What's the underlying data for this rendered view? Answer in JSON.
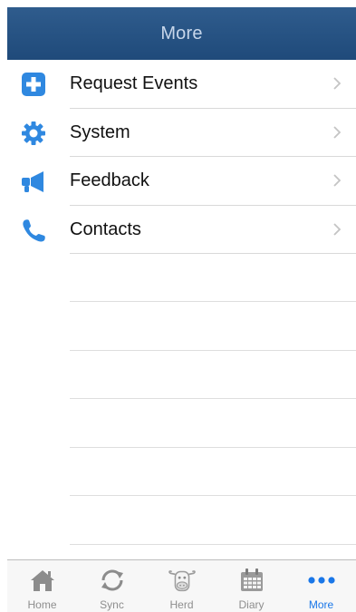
{
  "navbar": {
    "title": "More"
  },
  "menu": {
    "items": [
      {
        "label": "Request Events",
        "icon": "plus-square-icon"
      },
      {
        "label": "System",
        "icon": "gear-icon"
      },
      {
        "label": "Feedback",
        "icon": "megaphone-icon"
      },
      {
        "label": "Contacts",
        "icon": "phone-icon"
      }
    ]
  },
  "tabbar": {
    "tabs": [
      {
        "label": "Home",
        "icon": "house-icon",
        "active": false
      },
      {
        "label": "Sync",
        "icon": "sync-icon",
        "active": false
      },
      {
        "label": "Herd",
        "icon": "cow-icon",
        "active": false
      },
      {
        "label": "Diary",
        "icon": "calendar-icon",
        "active": false
      },
      {
        "label": "More",
        "icon": "more-dots-icon",
        "active": true
      }
    ]
  },
  "colors": {
    "nav_bar": "#1f4a7a",
    "accent": "#1a77e8",
    "icon_blue": "#2f88e0"
  }
}
